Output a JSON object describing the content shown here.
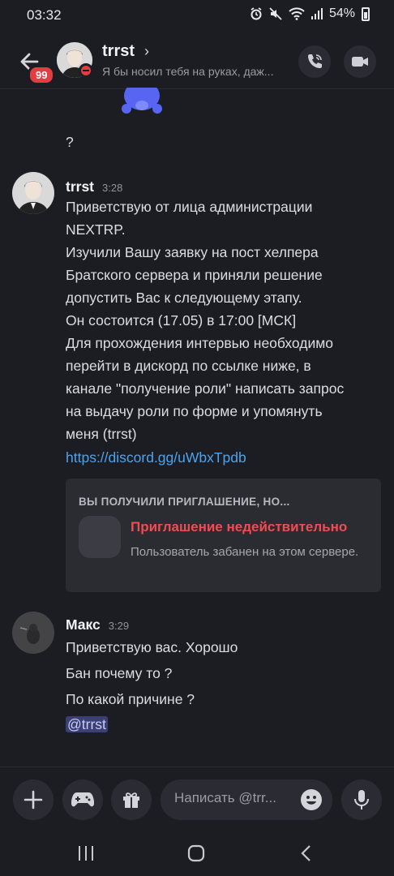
{
  "status_bar": {
    "time": "03:32",
    "battery": "54%"
  },
  "header": {
    "unread_badge": "99",
    "name": "trrst",
    "chevron": "›",
    "subtitle": "Я бы носил тебя на руках, даж..."
  },
  "messages": {
    "prev_tail": "?",
    "m1": {
      "author": "trrst",
      "time": "3:28",
      "lines": [
        "Приветствую от лица администрации",
        "NEXTRP.",
        "Изучили Вашу заявку на пост хелпера",
        "Братского сервера и приняли решение",
        "допустить Вас к следующему этапу.",
        "Он состоится (17.05) в 17:00 [МСК]",
        "Для прохождения интервью необходимо",
        "перейти в дискорд по ссылке ниже, в",
        "канале \"получение роли\" написать запрос",
        "на выдачу роли по форме и упомянуть",
        "меня (trrst)"
      ],
      "link": "https://discord.gg/uWbxTpdb",
      "invite": {
        "heading": "ВЫ ПОЛУЧИЛИ ПРИГЛАШЕНИЕ, НО...",
        "title": "Приглашение недействительно",
        "description": "Пользователь забанен на этом сервере."
      }
    },
    "m2": {
      "author": "Макс",
      "time": "3:29",
      "line1": "Приветствую вас.  Хорошо",
      "line2": "Бан почему то ?",
      "line3": "По какой причине ?",
      "mention": "@trrst"
    }
  },
  "input": {
    "placeholder": "Написать @trr..."
  },
  "colors": {
    "background": "#1c1d22",
    "link": "#4aa3f0",
    "danger": "#ee4d52",
    "badge": "#e23d41",
    "mention_bg": "#3b3f73"
  }
}
